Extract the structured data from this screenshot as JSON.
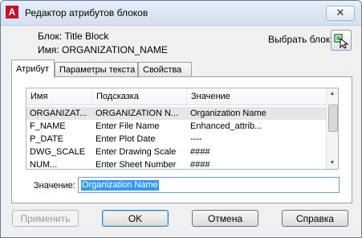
{
  "window": {
    "title": "Редактор атрибутов блоков",
    "close_glyph": "✕",
    "app_icon": "A"
  },
  "info": {
    "block_line": "Блок: Title Block",
    "name_line": "Имя: ORGANIZATION_NAME"
  },
  "pick": {
    "label": "Выбрать блок",
    "icon": "pick-block-icon"
  },
  "tabs": [
    {
      "label": "Атрибут"
    },
    {
      "label": "Параметры текста"
    },
    {
      "label": "Свойства"
    }
  ],
  "table": {
    "headers": [
      "Имя",
      "Подсказка",
      "Значение"
    ],
    "rows": [
      [
        "ORGANIZAT...",
        "ORGANIZATION N...",
        "Organization Name"
      ],
      [
        "F_NAME",
        "Enter File Name",
        "Enhanced_attrib..."
      ],
      [
        "P_DATE",
        "Enter Plot Date",
        "----"
      ],
      [
        "DWG_SCALE",
        "Enter Drawing Scale",
        "####"
      ],
      [
        "NUM...",
        "Enter Sheet Number",
        "####"
      ]
    ]
  },
  "value": {
    "label": "Значение:",
    "text": "Organization Name"
  },
  "buttons": {
    "apply": "Применить",
    "ok": "OK",
    "cancel": "Отмена",
    "help": "Справка"
  }
}
